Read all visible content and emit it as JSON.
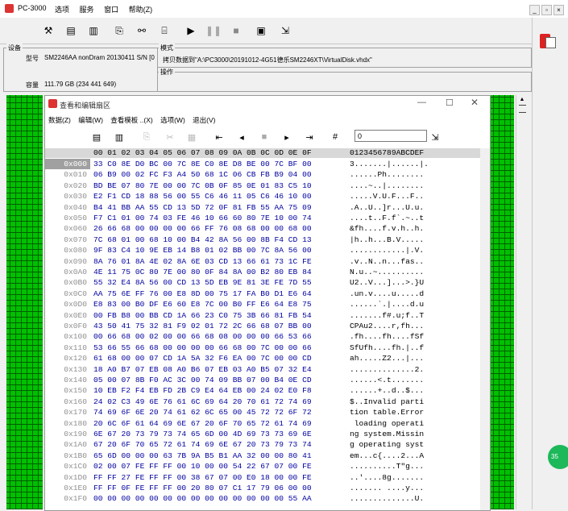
{
  "app": {
    "title": "PC-3000",
    "menu": [
      "选项",
      "服务",
      "窗口",
      "帮助(Z)"
    ]
  },
  "info": {
    "device_group": "设备",
    "model_label": "型号",
    "model_value": "SM2246AA nonDram 20130411 S/N [0",
    "capacity_label": "容量",
    "capacity_value": "111.79 GB (234 441 649)",
    "mode_group": "模式",
    "mode_value": "拷贝数据到\"A:\\PC3000\\20191012-4G51德乐SM2246XT\\VirtualDisk.vhdx\"",
    "operation_group": "操作"
  },
  "sub": {
    "title": "查看和编辑扇区",
    "menu": [
      "数据(Z)",
      "编辑(W)",
      "查看模板 ..(X)",
      "选项(W)",
      "退出(V)"
    ],
    "address_value": "0"
  },
  "hex": {
    "header_hex": "00 01 02 03 04 05 06 07 08 09 0A 0B 0C 0D 0E 0F",
    "header_ascii": "0123456789ABCDEF",
    "rows": [
      {
        "addr": "0x000",
        "hex": "33 C0 8E D0 BC 00 7C 8E C0 8E D8 BE 00 7C BF 00",
        "ascii": "3.......|......|."
      },
      {
        "addr": "0x010",
        "hex": "06 B9 00 02 FC F3 A4 50 68 1C 06 CB FB B9 04 00",
        "ascii": "......Ph........"
      },
      {
        "addr": "0x020",
        "hex": "BD BE 07 80 7E 00 00 7C 0B 0F 85 0E 01 83 C5 10",
        "ascii": "....~..|........"
      },
      {
        "addr": "0x030",
        "hex": "E2 F1 CD 18 88 56 00 55 C6 46 11 05 C6 46 10 00",
        "ascii": ".....V.U.F...F.."
      },
      {
        "addr": "0x040",
        "hex": "B4 41 BB AA 55 CD 13 5D 72 0F 81 FB 55 AA 75 09",
        "ascii": ".A..U..]r...U.u."
      },
      {
        "addr": "0x050",
        "hex": "F7 C1 01 00 74 03 FE 46 10 66 60 80 7E 10 00 74",
        "ascii": "....t..F.f`.~..t"
      },
      {
        "addr": "0x060",
        "hex": "26 66 68 00 00 00 00 66 FF 76 08 68 00 00 68 00",
        "ascii": "&fh....f.v.h..h."
      },
      {
        "addr": "0x070",
        "hex": "7C 68 01 00 68 10 00 B4 42 8A 56 00 8B F4 CD 13",
        "ascii": "|h..h...B.V....."
      },
      {
        "addr": "0x080",
        "hex": "9F 83 C4 10 9E EB 14 B8 01 02 BB 00 7C 8A 56 00",
        "ascii": "............|.V."
      },
      {
        "addr": "0x090",
        "hex": "8A 76 01 8A 4E 02 8A 6E 03 CD 13 66 61 73 1C FE",
        "ascii": ".v..N..n...fas.."
      },
      {
        "addr": "0x0A0",
        "hex": "4E 11 75 0C 80 7E 00 80 0F 84 8A 00 B2 80 EB 84",
        "ascii": "N.u..~.........."
      },
      {
        "addr": "0x0B0",
        "hex": "55 32 E4 8A 56 00 CD 13 5D EB 9E 81 3E FE 7D 55",
        "ascii": "U2..V...]...>.}U"
      },
      {
        "addr": "0x0C0",
        "hex": "AA 75 6E FF 76 00 E8 8D 00 75 17 FA B0 D1 E6 64",
        "ascii": ".un.v....u.....d"
      },
      {
        "addr": "0x0D0",
        "hex": "E8 83 00 B0 DF E6 60 E8 7C 00 B0 FF E6 64 E8 75",
        "ascii": "......`.|....d.u"
      },
      {
        "addr": "0x0E0",
        "hex": "00 FB B8 00 BB CD 1A 66 23 C0 75 3B 66 81 FB 54",
        "ascii": ".......f#.u;f..T"
      },
      {
        "addr": "0x0F0",
        "hex": "43 50 41 75 32 81 F9 02 01 72 2C 66 68 07 BB 00",
        "ascii": "CPAu2....r,fh..."
      },
      {
        "addr": "0x100",
        "hex": "00 66 68 00 02 00 00 66 68 08 00 00 00 66 53 66",
        "ascii": ".fh....fh....fSf"
      },
      {
        "addr": "0x110",
        "hex": "53 66 55 66 68 00 00 00 00 66 68 00 7C 00 00 66",
        "ascii": "SfUfh....fh.|..f"
      },
      {
        "addr": "0x120",
        "hex": "61 68 00 00 07 CD 1A 5A 32 F6 EA 00 7C 00 00 CD",
        "ascii": "ah.....Z2...|..."
      },
      {
        "addr": "0x130",
        "hex": "18 A0 B7 07 EB 08 A0 B6 07 EB 03 A0 B5 07 32 E4",
        "ascii": "..............2."
      },
      {
        "addr": "0x140",
        "hex": "05 00 07 8B F0 AC 3C 00 74 09 BB 07 00 B4 0E CD",
        "ascii": "......<.t......."
      },
      {
        "addr": "0x150",
        "hex": "10 EB F2 F4 EB FD 2B C9 E4 64 EB 00 24 02 E0 F8",
        "ascii": "......+..d..$..."
      },
      {
        "addr": "0x160",
        "hex": "24 02 C3 49 6E 76 61 6C 69 64 20 70 61 72 74 69",
        "ascii": "$..Invalid parti"
      },
      {
        "addr": "0x170",
        "hex": "74 69 6F 6E 20 74 61 62 6C 65 00 45 72 72 6F 72",
        "ascii": "tion table.Error"
      },
      {
        "addr": "0x180",
        "hex": "20 6C 6F 61 64 69 6E 67 20 6F 70 65 72 61 74 69",
        "ascii": " loading operati"
      },
      {
        "addr": "0x190",
        "hex": "6E 67 20 73 79 73 74 65 6D 00 4D 69 73 73 69 6E",
        "ascii": "ng system.Missin"
      },
      {
        "addr": "0x1A0",
        "hex": "67 20 6F 70 65 72 61 74 69 6E 67 20 73 79 73 74",
        "ascii": "g operating syst"
      },
      {
        "addr": "0x1B0",
        "hex": "65 6D 00 00 00 63 7B 9A B5 B1 AA 32 00 00 80 41",
        "ascii": "em...c{....2...A"
      },
      {
        "addr": "0x1C0",
        "hex": "02 00 07 FE FF FF 00 10 00 00 54 22 67 07 00 FE",
        "ascii": "..........T\"g..."
      },
      {
        "addr": "0x1D0",
        "hex": "FF FF 27 FE FF FF 00 38 67 07 00 E0 18 00 00 FE",
        "ascii": "..'....8g......."
      },
      {
        "addr": "0x1E0",
        "hex": "FF FF 0F FE FF FF 00 20 80 07 C1 17 79 06 00 00",
        "ascii": "....... ....y..."
      },
      {
        "addr": "0x1F0",
        "hex": "00 00 00 00 00 00 00 00 00 00 00 00 00 00 55 AA",
        "ascii": "..............U."
      }
    ]
  },
  "colors": {
    "accent_green": "#00c000",
    "hex_blue": "#0000a0",
    "selected_addr": "#a0a0a0"
  }
}
